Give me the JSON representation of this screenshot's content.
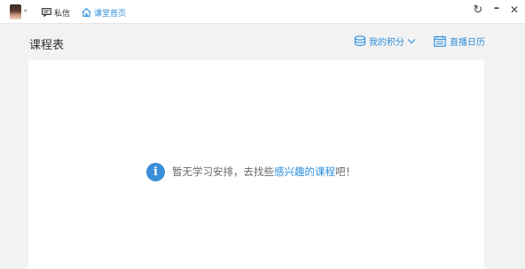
{
  "topbar": {
    "message_label": "私信",
    "home_label": "课堂首页",
    "icons": {
      "message": "chat-bubble-icon",
      "home": "home-icon",
      "refresh": "refresh-icon",
      "minimize": "minimize-icon",
      "close": "close-icon"
    }
  },
  "header": {
    "title": "课程表",
    "points_label": "我的积分",
    "calendar_label": "直播日历"
  },
  "empty_state": {
    "text_before": "暂无学习安排，去找些",
    "link_text": "感兴趣的课程",
    "text_after": "吧！"
  },
  "colors": {
    "accent": "#2f8fdd",
    "background": "#f2f2f2",
    "card": "#ffffff"
  }
}
